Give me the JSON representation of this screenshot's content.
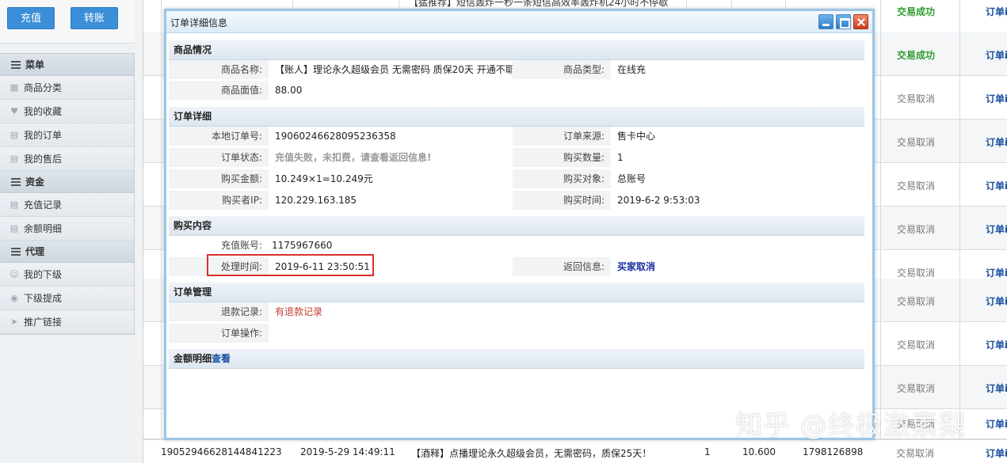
{
  "sidebar": {
    "recharge_label": "充值",
    "transfer_label": "转账",
    "groups": [
      {
        "title": "菜单",
        "items": [
          {
            "label": "商品分类",
            "icon": "grid-icon"
          },
          {
            "label": "我的收藏",
            "icon": "heart-icon"
          },
          {
            "label": "我的订单",
            "icon": "doc-icon"
          },
          {
            "label": "我的售后",
            "icon": "doc-icon"
          }
        ]
      },
      {
        "title": "资金",
        "items": [
          {
            "label": "充值记录",
            "icon": "doc-icon"
          },
          {
            "label": "余额明细",
            "icon": "doc-icon"
          }
        ]
      },
      {
        "title": "代理",
        "items": [
          {
            "label": "我的下级",
            "icon": "users-icon"
          },
          {
            "label": "下级提成",
            "icon": "coin-icon"
          },
          {
            "label": "推广链接",
            "icon": "send-icon"
          }
        ]
      }
    ]
  },
  "table": {
    "top_partial_text": "【猛推荐】短信轰炸一秒一条短信高效率轰炸机24小时不停歇",
    "row_statuses": [
      "交易成功",
      "交易成功",
      "交易取消",
      "交易取消",
      "交易取消",
      "交易取消",
      "交易取消",
      "交易取消",
      "交易取消",
      "交易取消"
    ],
    "row_link": "订单i",
    "last_row": {
      "order_no": "19052946628144841223",
      "time": "2019-5-29 14:49:11",
      "product": "【酒释】点播理论永久超级会员，无需密码，质保25天！",
      "qty": "1",
      "amount": "10.600",
      "account": "1798126898",
      "status": "交易取消",
      "link": "订单i"
    }
  },
  "dialog": {
    "title": "订单详细信息",
    "sections": {
      "product": "商品情况",
      "order": "订单详细",
      "purchase": "购买内容",
      "manage": "订单管理",
      "balance": "金额明细",
      "balance_link": "查看"
    },
    "fields": {
      "product_name_label": "商品名称:",
      "product_name": "【账人】理论永久超级会员 无需密码 质保20天 开通不耶",
      "product_type_label": "商品类型:",
      "product_type": "在线充",
      "face_value_label": "商品面值:",
      "face_value": "88.00",
      "local_order_label": "本地订单号:",
      "local_order": "19060246628095236358",
      "order_source_label": "订单来源:",
      "order_source": "售卡中心",
      "order_status_label": "订单状态:",
      "order_status": "充值失败，未扣费，请查看返回信息!",
      "quantity_label": "购买数量:",
      "quantity": "1",
      "amount_label": "购买金额:",
      "amount": "10.249×1=10.249元",
      "target_label": "购买对象:",
      "target": "总账号",
      "ip_label": "购买者IP:",
      "ip": "120.229.163.185",
      "buy_time_label": "购买时间:",
      "buy_time": "2019-6-2 9:53:03",
      "account_label": "充值账号:",
      "account": "1175967660",
      "process_time_label": "处理时间:",
      "process_time": "2019-6-11 23:50:51",
      "return_label": "返回信息:",
      "return_value": "买家取消",
      "refund_label": "退款记录:",
      "refund_value": "有退款记录",
      "op_label": "订单操作:"
    }
  },
  "watermark": "知乎 @终极激素梨"
}
